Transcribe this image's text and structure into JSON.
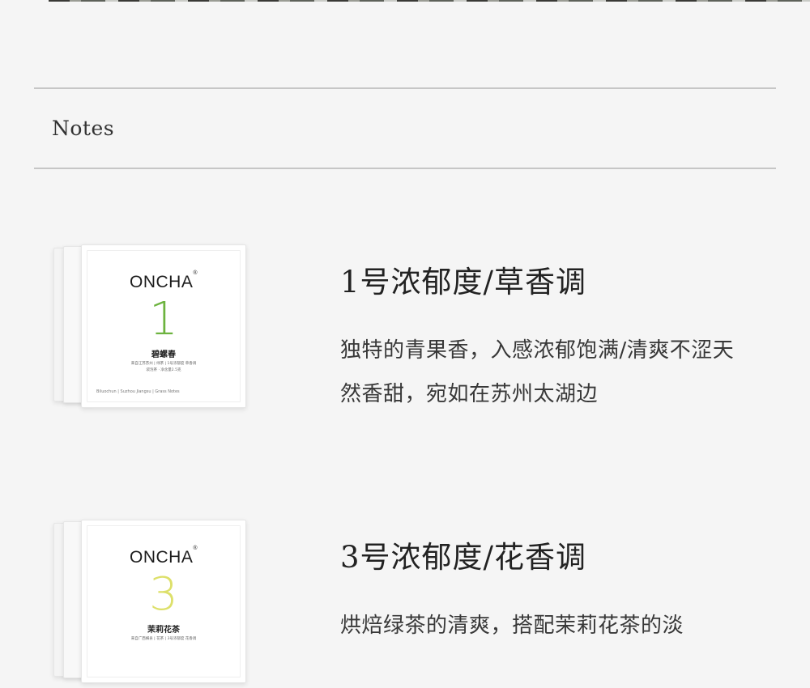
{
  "section": {
    "title": "Notes"
  },
  "products": [
    {
      "pack": {
        "brand": "ONCHA",
        "brand_mark": "®",
        "number": "1",
        "number_color": "#6db33f",
        "tea_name": "碧螺春",
        "sub_line_1": "来自江苏苏州 | 绿茶 | 1号浓郁度 草香调",
        "sub_line_2": "袋泡茶 · 净含量2.5克",
        "footer": "Biluochun  |  Suzhou Jiangsu  |  Grass Notes"
      },
      "title": "1号浓郁度/草香调",
      "description": "独特的青果香，入感浓郁饱满/清爽不涩天然香甜，宛如在苏州太湖边"
    },
    {
      "pack": {
        "brand": "ONCHA",
        "brand_mark": "®",
        "number": "3",
        "number_color": "#dde06a",
        "tea_name": "茉莉花茶",
        "sub_line_1": "来自广西横县 | 花茶 | 3号浓郁度 花香调",
        "sub_line_2": "",
        "footer": ""
      },
      "title": "3号浓郁度/花香调",
      "description": "烘焙绿茶的清爽，搭配茉莉花茶的淡"
    }
  ]
}
